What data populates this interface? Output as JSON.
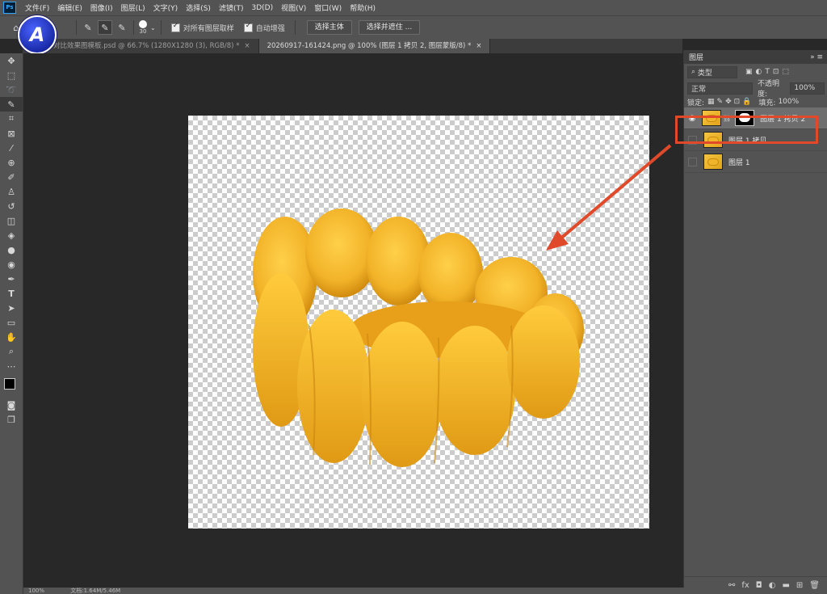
{
  "app": {
    "logo": "Ps"
  },
  "menu": [
    "文件(F)",
    "编辑(E)",
    "图像(I)",
    "图层(L)",
    "文字(Y)",
    "选择(S)",
    "滤镜(T)",
    "3D(D)",
    "视图(V)",
    "窗口(W)",
    "帮助(H)"
  ],
  "options": {
    "brush_size": "30",
    "sample_all_layers": "对所有图层取样",
    "auto_enhance": "自动增强",
    "select_subject": "选择主体",
    "select_and_mask": "选择并遮住 ..."
  },
  "badge": {
    "letter": "A"
  },
  "tabs": [
    {
      "label": "对比效果图模板.psd @ 66.7% (1280X1280 (3), RGB/8) *",
      "close": "×"
    },
    {
      "label": "20260917-161424.png @ 100% (图层 1 拷贝 2, 图层蒙版/8) *",
      "close": "×"
    }
  ],
  "layers_panel": {
    "title": "图层",
    "filter_kind": "类型",
    "blend_mode": "正常",
    "opacity_label": "不透明度:",
    "opacity_value": "100%",
    "lock_label": "锁定:",
    "fill_label": "填充:",
    "fill_value": "100%",
    "layers": [
      {
        "name": "图层 1 拷贝 2",
        "visible": true,
        "has_mask": true,
        "selected": true
      },
      {
        "name": "图层 1 拷贝",
        "visible": false,
        "has_mask": false,
        "selected": false
      },
      {
        "name": "图层 1",
        "visible": false,
        "has_mask": false,
        "selected": false
      }
    ]
  },
  "status": {
    "zoom": "100%",
    "doc": "文档:1.64M/5.46M"
  },
  "colors": {
    "accent_annotation": "#e04a2b",
    "sofa": "#f2b328"
  }
}
